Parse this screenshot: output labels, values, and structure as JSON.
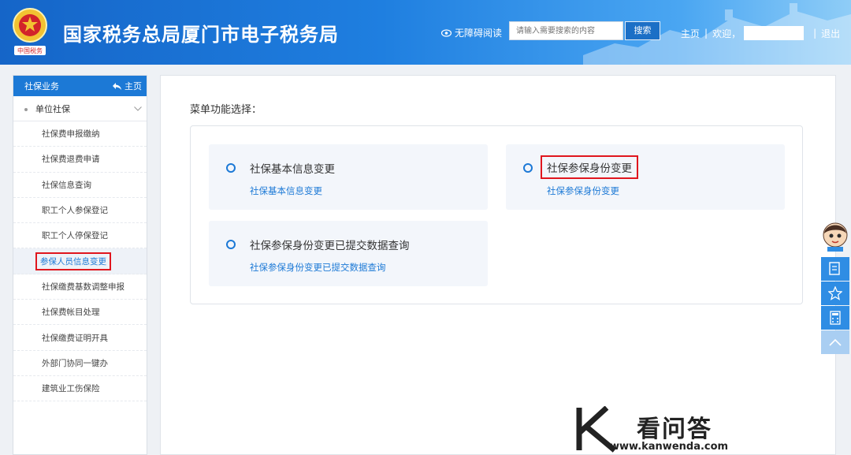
{
  "header": {
    "title": "国家税务总局厦门市电子税务局",
    "accessibility": "无障碍阅读",
    "search_placeholder": "请输入需要搜索的内容",
    "search_button": "搜索",
    "home_link": "主页",
    "welcome": "欢迎，",
    "logout": "退出"
  },
  "sidebar": {
    "header_title": "社保业务",
    "home_label": "主页",
    "group": "单位社保",
    "items": [
      {
        "label": "社保费申报缴纳"
      },
      {
        "label": "社保费退费申请"
      },
      {
        "label": "社保信息查询"
      },
      {
        "label": "职工个人参保登记"
      },
      {
        "label": "职工个人停保登记"
      },
      {
        "label": "参保人员信息变更",
        "active": true
      },
      {
        "label": "社保缴费基数调整申报"
      },
      {
        "label": "社保费帐目处理"
      },
      {
        "label": "社保缴费证明开具"
      },
      {
        "label": "外部门协同一键办"
      },
      {
        "label": "建筑业工伤保险"
      }
    ]
  },
  "main": {
    "menu_title": "菜单功能选择：",
    "cards": [
      {
        "title": "社保基本信息变更",
        "sub": "社保基本信息变更"
      },
      {
        "title": "社保参保身份变更",
        "sub": "社保参保身份变更",
        "highlighted": true
      },
      {
        "title": "社保参保身份变更已提交数据查询",
        "sub": "社保参保身份变更已提交数据查询"
      }
    ]
  },
  "watermark": {
    "brand": "看问答",
    "url": "www.kanwenda.com"
  },
  "colors": {
    "primary": "#1c79d6",
    "highlight": "#e0161e",
    "card_bg": "#f3f6fb"
  },
  "icons": {
    "emblem": "tax-emblem-icon",
    "eye": "eye-icon",
    "back": "back-arrow-icon",
    "chevron": "chevron-down-icon",
    "radio": "radio-icon",
    "float": [
      "assistant-avatar-icon",
      "form-icon",
      "star-icon",
      "calculator-icon",
      "chevron-up-icon"
    ]
  }
}
